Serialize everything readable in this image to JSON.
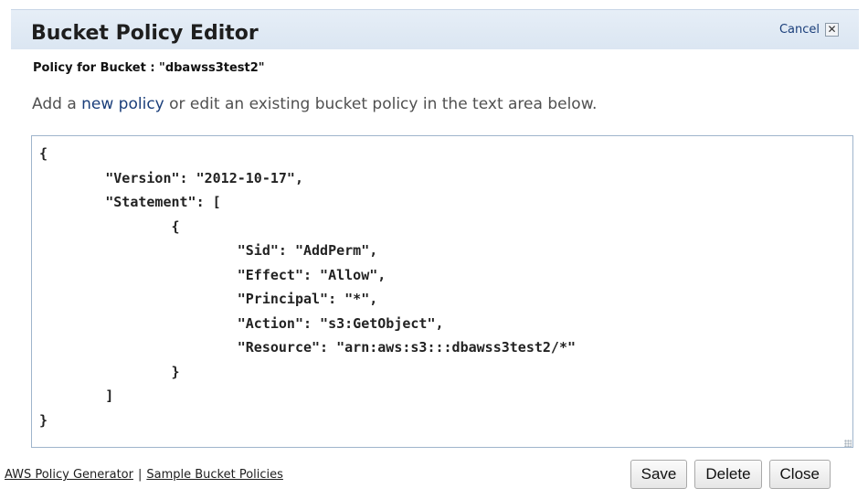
{
  "dialog": {
    "title": "Bucket Policy Editor",
    "cancel_label": "Cancel",
    "close_glyph": "✕",
    "subheader": "Policy for Bucket : \"dbawss3test2\"",
    "instructions": {
      "prefix": "Add a ",
      "link": "new policy",
      "suffix": " or edit an existing bucket policy in the text area below."
    },
    "policy_text": "{\n        \"Version\": \"2012-10-17\",\n        \"Statement\": [\n                {\n                        \"Sid\": \"AddPerm\",\n                        \"Effect\": \"Allow\",\n                        \"Principal\": \"*\",\n                        \"Action\": \"s3:GetObject\",\n                        \"Resource\": \"arn:aws:s3:::dbawss3test2/*\"\n                }\n        ]\n}",
    "footer": {
      "link1": "AWS Policy Generator",
      "separator": "|",
      "link2": "Sample Bucket Policies"
    },
    "buttons": {
      "save": "Save",
      "delete": "Delete",
      "close": "Close"
    }
  },
  "colors": {
    "titlebar": "#dbe6f2",
    "link": "#1a3e7a",
    "editor_border": "#9fb5cc"
  }
}
